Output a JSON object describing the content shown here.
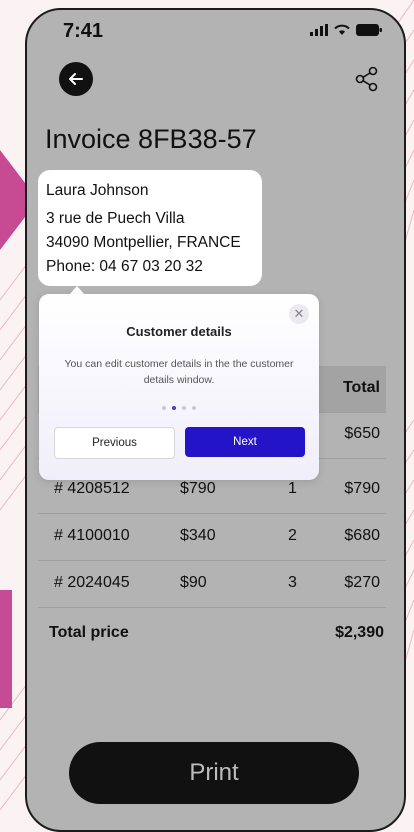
{
  "status_bar": {
    "time": "7:41"
  },
  "header": {
    "back_icon": "arrow-left-icon",
    "share_icon": "share-icon"
  },
  "invoice": {
    "title": "Invoice 8FB38-57",
    "customer": {
      "name": "Laura Johnson",
      "street": "3 rue de Puech Villa",
      "city": "34090 Montpellier, FRANCE",
      "phone": "Phone: 04 67 03 20 32"
    },
    "table": {
      "header_total": "Total",
      "rows": [
        {
          "item": "",
          "price": "",
          "qty": "",
          "total": "$650"
        },
        {
          "item": "# 4208512",
          "price": "$790",
          "qty": "1",
          "total": "$790"
        },
        {
          "item": "# 4100010",
          "price": "$340",
          "qty": "2",
          "total": "$680"
        },
        {
          "item": "# 2024045",
          "price": "$90",
          "qty": "3",
          "total": "$270"
        }
      ]
    },
    "total_label": "Total price",
    "total_value": "$2,390"
  },
  "tooltip": {
    "close_icon": "close-icon",
    "title": "Customer details",
    "body": "You can edit customer details in the the customer details window.",
    "steps": 4,
    "active_step": 2,
    "previous_label": "Previous",
    "next_label": "Next"
  },
  "print_label": "Print",
  "colors": {
    "accent": "#2414c7",
    "screen_gray": "#b3b3b3",
    "decor_pink": "#c64b93"
  }
}
